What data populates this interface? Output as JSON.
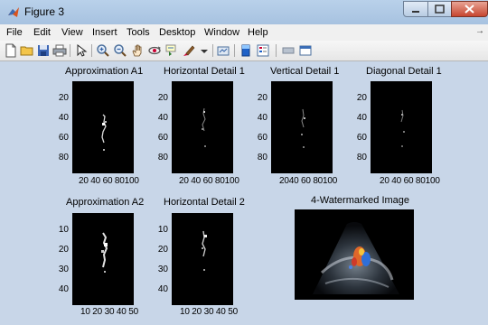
{
  "window": {
    "title": "Figure 3"
  },
  "menu": {
    "items": [
      "File",
      "Edit",
      "View",
      "Insert",
      "Tools",
      "Desktop",
      "Window",
      "Help"
    ],
    "extra": "→"
  },
  "toolbar": {
    "icons": [
      "new-figure-icon",
      "open-file-icon",
      "save-icon",
      "print-icon",
      "pointer-icon",
      "zoom-in-icon",
      "zoom-out-icon",
      "pan-icon",
      "rotate-3d-icon",
      "data-cursor-icon",
      "brush-icon",
      "link-icon",
      "colorbar-icon",
      "legend-icon",
      "hide-plot-tools-icon",
      "show-plot-tools-icon"
    ]
  },
  "panels": [
    {
      "title": "Approximation A1",
      "yticks": [
        "20",
        "40",
        "60",
        "80"
      ],
      "xticks": "20 40 60 80100"
    },
    {
      "title": "Horizontal Detail 1",
      "yticks": [
        "20",
        "40",
        "60",
        "80"
      ],
      "xticks": "20 40 60 80100"
    },
    {
      "title": "Vertical Detail 1",
      "yticks": [
        "20",
        "40",
        "60",
        "80"
      ],
      "xticks": "2040 60 80100"
    },
    {
      "title": "Diagonal Detail 1",
      "yticks": [
        "20",
        "40",
        "60",
        "80"
      ],
      "xticks": "20 40 60 80100"
    },
    {
      "title": "Approximation A2",
      "yticks": [
        "10",
        "20",
        "30",
        "40"
      ],
      "xticks": "10 20 30 40 50"
    },
    {
      "title": "Horizontal Detail 2",
      "yticks": [
        "10",
        "20",
        "30",
        "40"
      ],
      "xticks": "10 20 30 40 50"
    }
  ],
  "watermarked": {
    "title": "4-Watermarked Image"
  },
  "colors": {
    "titlebar": "#b9d1ea",
    "figure_bg": "#c8d6e8",
    "close_button": "#c7452f"
  }
}
